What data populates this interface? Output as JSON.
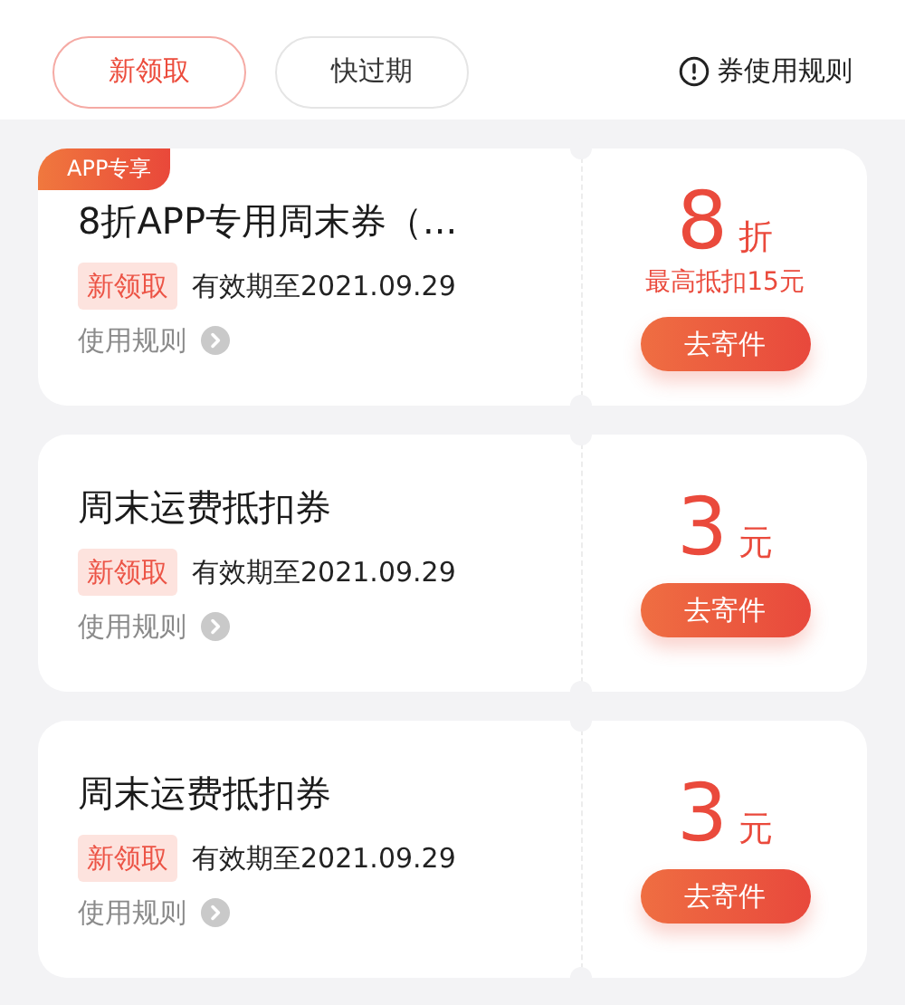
{
  "filters": [
    {
      "label": "新领取",
      "selected": true
    },
    {
      "label": "快过期",
      "selected": false
    }
  ],
  "rules_link": {
    "label": "券使用规则"
  },
  "coupons": [
    {
      "badge": "APP专享",
      "title": "8折APP专用周末券（...",
      "tag": "新领取",
      "validity": "有效期至2021.09.29",
      "rules": "使用规则",
      "amount": "8",
      "unit": "折",
      "note": "最高抵扣15元",
      "button": "去寄件"
    },
    {
      "title": "周末运费抵扣券",
      "tag": "新领取",
      "validity": "有效期至2021.09.29",
      "rules": "使用规则",
      "amount": "3",
      "unit": "元",
      "button": "去寄件"
    },
    {
      "title": "周末运费抵扣券",
      "tag": "新领取",
      "validity": "有效期至2021.09.29",
      "rules": "使用规则",
      "amount": "3",
      "unit": "元",
      "button": "去寄件"
    }
  ]
}
